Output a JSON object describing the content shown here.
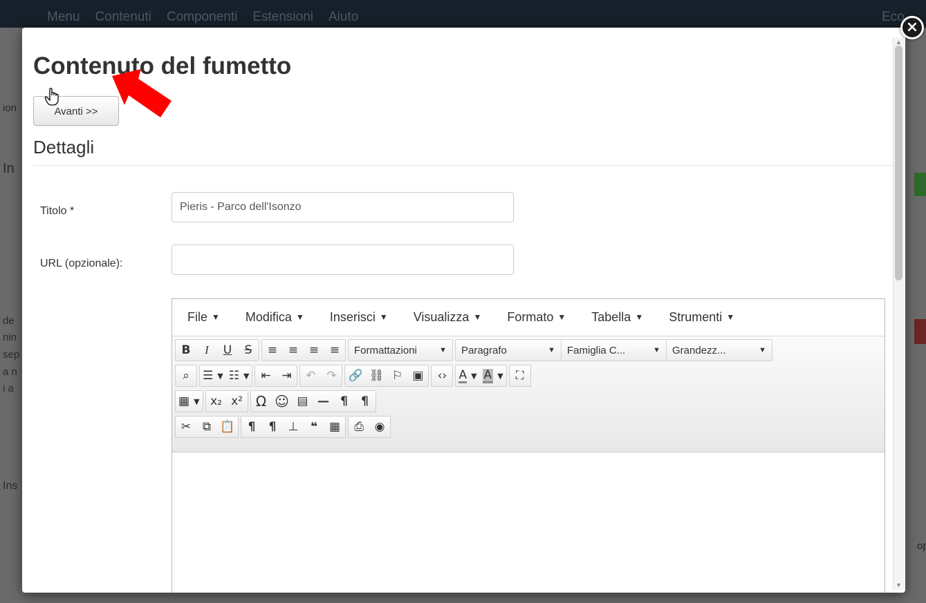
{
  "background": {
    "menu": [
      "Menu",
      "Contenuti",
      "Componenti",
      "Estensioni",
      "Aiuto"
    ],
    "right_label": "Eco",
    "left_fragments": [
      "ion",
      "In",
      "de",
      "nin",
      "sep",
      "a n",
      "i a",
      "Ins"
    ],
    "right_fragment": "op"
  },
  "modal": {
    "title": "Contenuto del fumetto",
    "next_button": "Avanti >>",
    "section_title": "Dettagli",
    "fields": {
      "title_label": "Titolo *",
      "title_value": "Pieris - Parco dell'Isonzo",
      "url_label": "URL (opzionale):",
      "url_value": ""
    }
  },
  "editor": {
    "menubar": [
      "File",
      "Modifica",
      "Inserisci",
      "Visualizza",
      "Formato",
      "Tabella",
      "Strumenti"
    ],
    "selects": {
      "formats": "Formattazioni",
      "block": "Paragrafo",
      "font_family": "Famiglia C...",
      "font_size": "Grandezz..."
    },
    "glyphs": {
      "bold": "B",
      "italic": "I",
      "underline": "U",
      "strike": "S",
      "align_left": "≡",
      "align_center": "≡",
      "align_right": "≡",
      "justify": "≡",
      "find": "⌕",
      "bullist": "☰",
      "numlist": "☷",
      "outdent": "⇤",
      "indent": "⇥",
      "undo": "↶",
      "redo": "↷",
      "link": "🔗",
      "unlink": "⛓",
      "anchor": "⚐",
      "image": "▣",
      "code": "‹›",
      "forecolor": "A",
      "backcolor": "A",
      "fullscreen": "⛶",
      "table": "▦",
      "subscript": "x₂",
      "superscript": "x²",
      "charmap": "Ω",
      "emoticons": "☺",
      "media": "▤",
      "hr": "—",
      "ltr": "¶",
      "rtl": "¶",
      "cut": "✂",
      "copy": "⧉",
      "paste": "📋",
      "pilcrow1": "¶",
      "pilcrow2": "¶",
      "template": "⊥",
      "blockquote": "❝",
      "preview_grid": "▦",
      "print": "⎙",
      "preview": "◉"
    }
  },
  "colors": {
    "arrow": "#ff0000",
    "topbar": "#15202a"
  }
}
